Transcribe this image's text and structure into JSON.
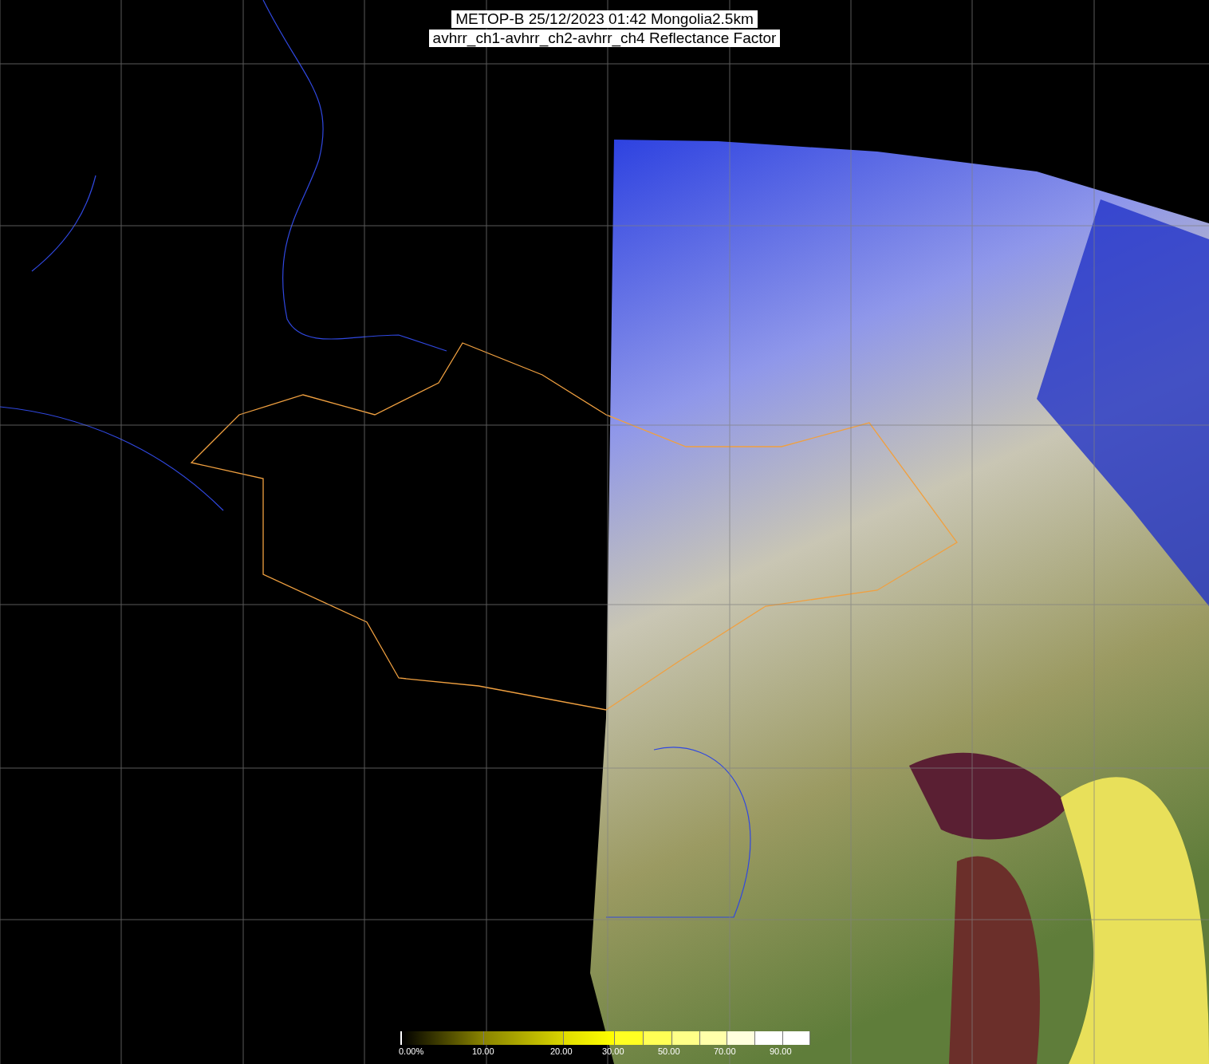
{
  "title": {
    "lines": [
      "METOP-B 25/12/2023 01:42 Mongolia2.5km",
      "avhrr_ch1-avhrr_ch2-avhrr_ch4 Reflectance Factor"
    ]
  },
  "legend": {
    "labels": [
      "0.00%",
      "10.00",
      "20.00",
      "30.00",
      "50.00",
      "70.00",
      "90.00"
    ]
  }
}
